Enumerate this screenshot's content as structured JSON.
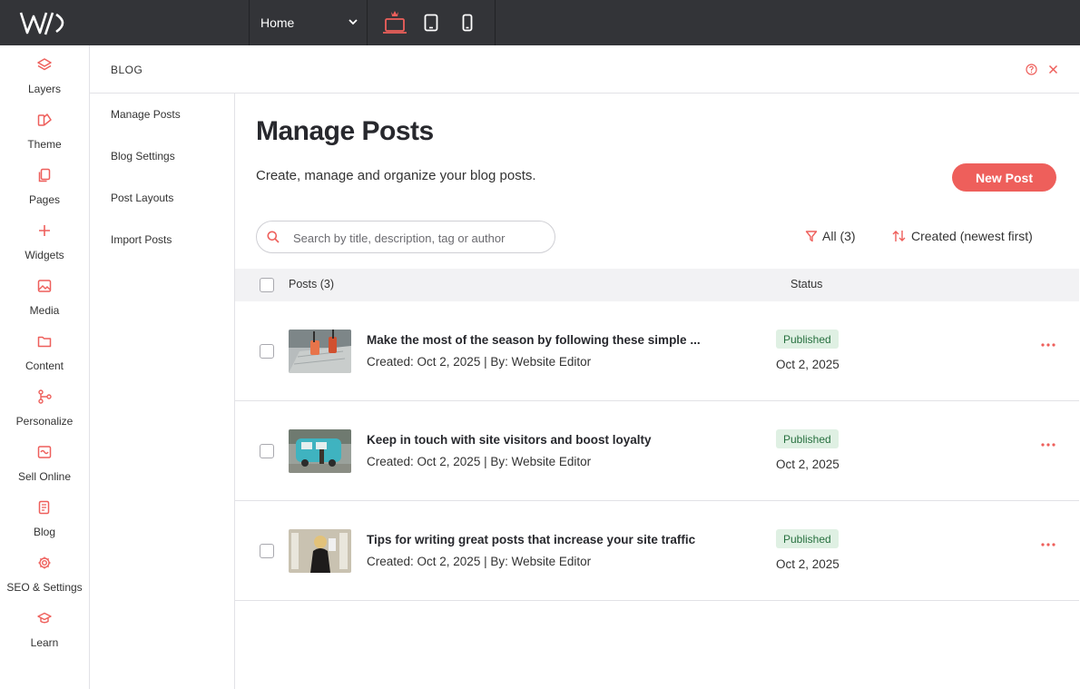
{
  "topbar": {
    "logo": "W/D",
    "page_select": "Home",
    "devices": [
      "desktop-icon",
      "tablet-icon",
      "mobile-icon"
    ],
    "accent": "#ee5f5b"
  },
  "rail": {
    "items": [
      {
        "label": "Layers",
        "icon": "layers-icon"
      },
      {
        "label": "Theme",
        "icon": "theme-icon"
      },
      {
        "label": "Pages",
        "icon": "pages-icon"
      },
      {
        "label": "Widgets",
        "icon": "plus-icon"
      },
      {
        "label": "Media",
        "icon": "image-icon"
      },
      {
        "label": "Content",
        "icon": "folder-icon"
      },
      {
        "label": "Personalize",
        "icon": "personalize-icon"
      },
      {
        "label": "Sell Online",
        "icon": "store-icon"
      },
      {
        "label": "Blog",
        "icon": "blog-icon"
      },
      {
        "label": "SEO & Settings",
        "icon": "gear-icon"
      },
      {
        "label": "Learn",
        "icon": "graduation-cap-icon"
      }
    ]
  },
  "panel": {
    "title": "BLOG"
  },
  "subnav": {
    "items": [
      "Manage Posts",
      "Blog Settings",
      "Post Layouts",
      "Import Posts"
    ]
  },
  "main": {
    "title": "Manage Posts",
    "subtitle": "Create, manage and organize your blog posts.",
    "new_post": "New Post",
    "search_placeholder": "Search by title, description, tag or author",
    "filter": "All (3)",
    "sort": "Created (newest first)",
    "columns": {
      "posts": "Posts (3)",
      "status": "Status"
    },
    "posts": [
      {
        "title": "Make the most of the season by following these simple ...",
        "meta": "Created: Oct 2, 2025 | By: Website Editor",
        "status": "Published",
        "date": "Oct 2, 2025"
      },
      {
        "title": "Keep in touch with site visitors and boost loyalty",
        "meta": "Created: Oct 2, 2025 | By: Website Editor",
        "status": "Published",
        "date": "Oct 2, 2025"
      },
      {
        "title": "Tips for writing great posts that increase your site traffic",
        "meta": "Created: Oct 2, 2025 | By: Website Editor",
        "status": "Published",
        "date": "Oct 2, 2025"
      }
    ]
  }
}
